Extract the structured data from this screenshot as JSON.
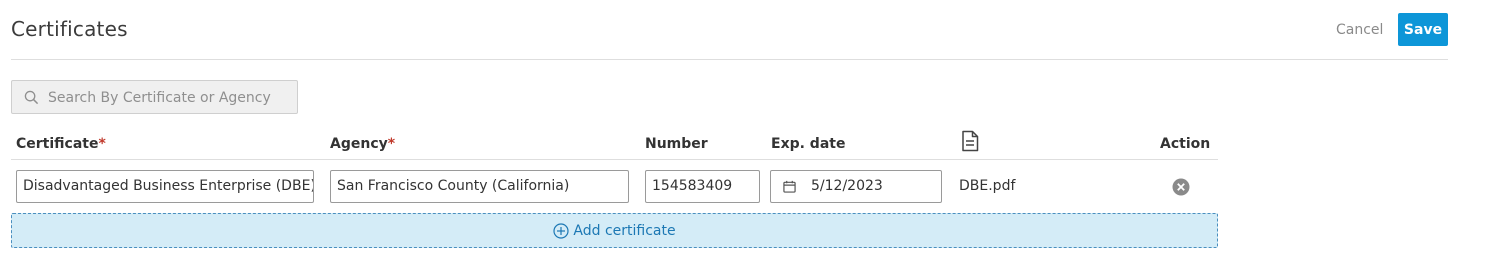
{
  "header": {
    "title": "Certificates",
    "cancel_label": "Cancel",
    "save_label": "Save"
  },
  "search": {
    "placeholder": "Search By Certificate or Agency",
    "icon": "search-icon"
  },
  "table": {
    "columns": [
      {
        "label": "Certificate",
        "required": true
      },
      {
        "label": "Agency",
        "required": true
      },
      {
        "label": "Number",
        "required": false
      },
      {
        "label": "Exp. date",
        "required": false
      },
      {
        "icon": "document-icon"
      },
      {
        "label": "Action",
        "required": false
      }
    ],
    "rows": [
      {
        "certificate": "Disadvantaged Business Enterprise (DBE)",
        "agency": "San Francisco County (California)",
        "number": "154583409",
        "exp_date": "5/12/2023",
        "file": "DBE.pdf",
        "action_icon": "remove-circle-icon"
      }
    ]
  },
  "add_button": {
    "label": "Add certificate",
    "icon": "plus-circle-icon"
  },
  "colors": {
    "primary": "#0d96d8",
    "required": "#c0392b",
    "add_bg": "#d4ecf7",
    "add_text": "#1c78b4"
  }
}
